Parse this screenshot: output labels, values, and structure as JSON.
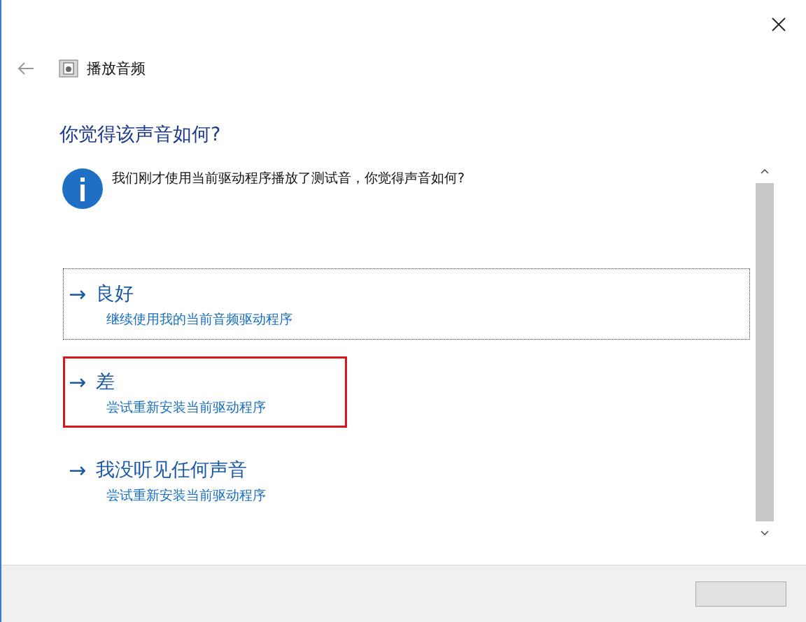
{
  "window": {
    "title": "播放音频"
  },
  "heading": "你觉得该声音如何?",
  "message": "我们刚才使用当前驱动程序播放了测试音，你觉得声音如何?",
  "options": [
    {
      "arrow": "→",
      "title": "良好",
      "description": "继续使用我的当前音频驱动程序",
      "focused": true,
      "highlighted": false
    },
    {
      "arrow": "→",
      "title": "差",
      "description": "尝试重新安装当前驱动程序",
      "focused": false,
      "highlighted": true
    },
    {
      "arrow": "→",
      "title": "我没听见任何声音",
      "description": "尝试重新安装当前驱动程序",
      "focused": false,
      "highlighted": false
    }
  ]
}
